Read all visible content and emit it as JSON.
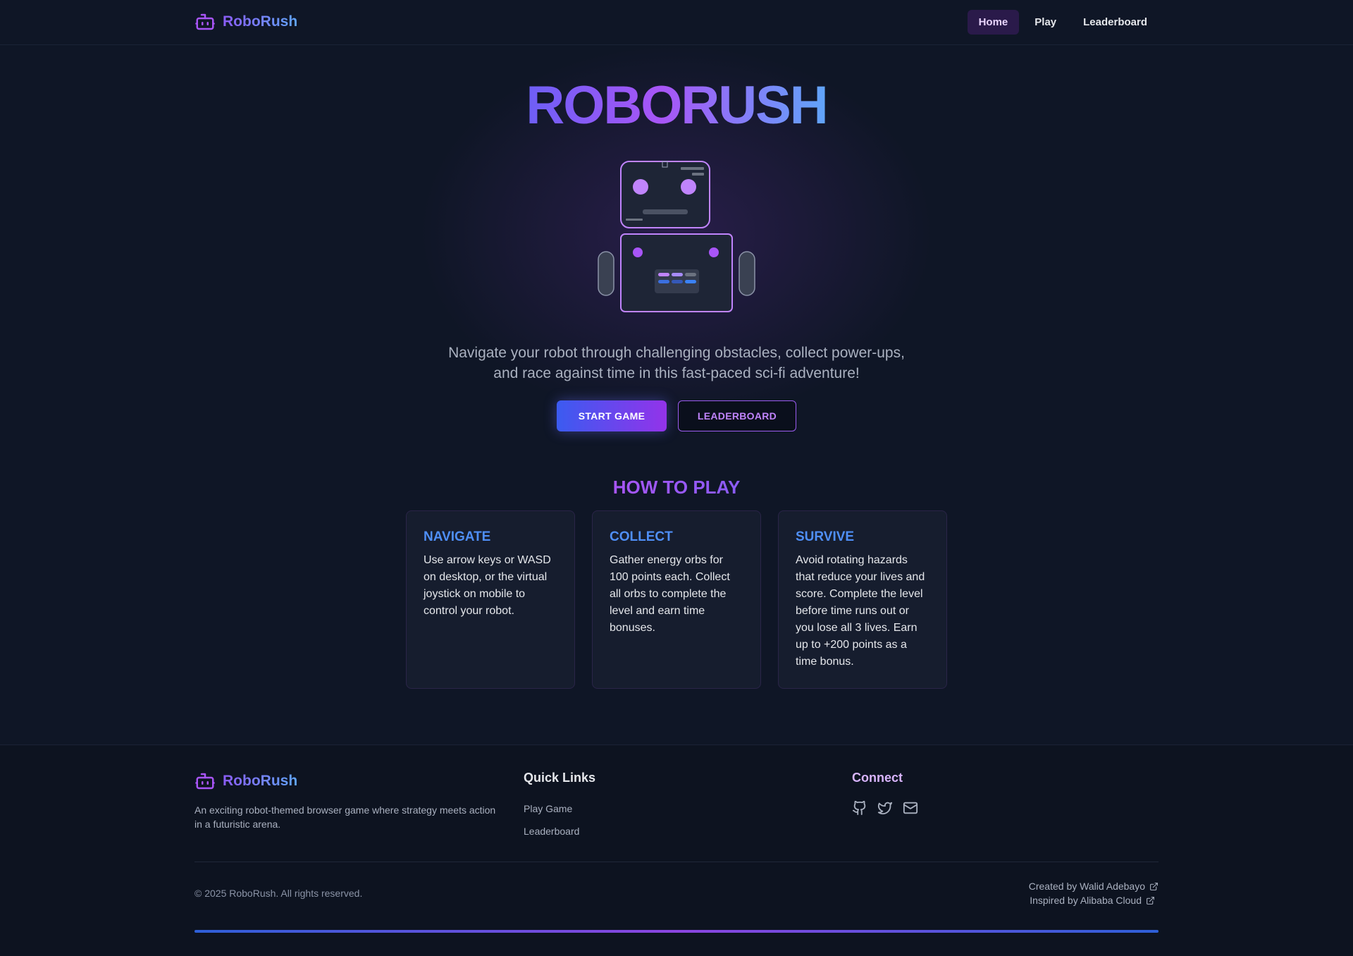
{
  "colors": {
    "background": "#0f1626",
    "accent_purple": "#a855f7",
    "accent_blue": "#4f8ff7",
    "card_background": "#161d2e"
  },
  "nav": {
    "brand": "RoboRush",
    "brand_icon": "robot-icon",
    "links": [
      {
        "label": "Home",
        "active": true
      },
      {
        "label": "Play",
        "active": false
      },
      {
        "label": "Leaderboard",
        "active": false
      }
    ]
  },
  "hero": {
    "title": "ROBORUSH",
    "tagline_line1": "Navigate your robot through challenging obstacles, collect power-ups,",
    "tagline_line2": "and race against time in this fast-paced sci-fi adventure!",
    "primary_button": "START GAME",
    "secondary_button": "LEADERBOARD"
  },
  "how_to_play": {
    "title": "HOW TO PLAY",
    "cards": [
      {
        "title": "NAVIGATE",
        "text": "Use arrow keys or WASD on desktop, or the virtual joystick on mobile to control your robot."
      },
      {
        "title": "COLLECT",
        "text": "Gather energy orbs for 100 points each. Collect all orbs to complete the level and earn time bonuses."
      },
      {
        "title": "SURVIVE",
        "text": "Avoid rotating hazards that reduce your lives and score. Complete the level before time runs out or you lose all 3 lives. Earn up to +200 points as a time bonus."
      }
    ]
  },
  "footer": {
    "brand": "RoboRush",
    "description": "An exciting robot-themed browser game where strategy meets action in a futuristic arena.",
    "quick_links_title": "Quick Links",
    "quick_links": [
      "Play Game",
      "Leaderboard"
    ],
    "connect_title": "Connect",
    "socials": [
      "github-icon",
      "twitter-icon",
      "mail-icon"
    ],
    "copyright": "© 2025 RoboRush. All rights reserved.",
    "credit_1": "Created by Walid Adebayo",
    "credit_2": "Inspired by Alibaba Cloud"
  }
}
